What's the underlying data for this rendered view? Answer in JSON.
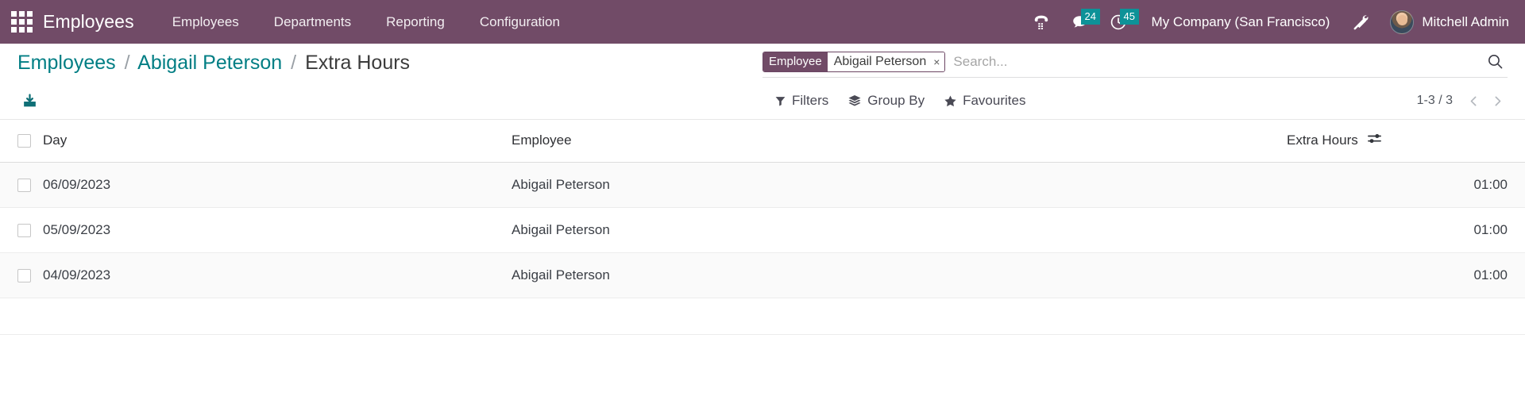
{
  "navbar": {
    "apps_icon": "apps-grid-icon",
    "brand": "Employees",
    "menu": [
      {
        "label": "Employees"
      },
      {
        "label": "Departments"
      },
      {
        "label": "Reporting"
      },
      {
        "label": "Configuration"
      }
    ],
    "systray": {
      "voip_icon": "phone-keypad-icon",
      "messages_icon": "chat-bubble-icon",
      "messages_count": "24",
      "activities_icon": "clock-icon",
      "activities_count": "45",
      "company": "My Company (San Francisco)",
      "debug_icon": "tools-wrench-screwdriver-icon",
      "user_name": "Mitchell Admin",
      "badge_color": "#0d9298"
    }
  },
  "control_panel": {
    "breadcrumb": {
      "root": "Employees",
      "parent": "Abigail Peterson",
      "current": "Extra Hours",
      "separator": "/"
    },
    "search": {
      "facet_label": "Employee",
      "facet_value": "Abigail Peterson",
      "facet_remove": "×",
      "placeholder": "Search...",
      "value": "",
      "search_icon": "magnifier-icon"
    },
    "actions": {
      "export_icon": "download-export-icon"
    },
    "dropdowns": [
      {
        "label": "Filters",
        "icon": "funnel-icon"
      },
      {
        "label": "Group By",
        "icon": "layers-icon"
      },
      {
        "label": "Favourites",
        "icon": "star-icon"
      }
    ],
    "pager": {
      "value": "1-3 / 3",
      "prev_icon": "chevron-left-icon",
      "next_icon": "chevron-right-icon"
    }
  },
  "list": {
    "columns": {
      "select_all": "select-all-checkbox",
      "day": "Day",
      "employee": "Employee",
      "extra_hours": "Extra Hours",
      "optional_columns_icon": "sliders-icon"
    },
    "rows": [
      {
        "day": "06/09/2023",
        "employee": "Abigail Peterson",
        "extra_hours": "01:00"
      },
      {
        "day": "05/09/2023",
        "employee": "Abigail Peterson",
        "extra_hours": "01:00"
      },
      {
        "day": "04/09/2023",
        "employee": "Abigail Peterson",
        "extra_hours": "01:00"
      }
    ]
  },
  "theme": {
    "navbar_bg": "#714B67",
    "link_teal": "#017e84",
    "badge_teal": "#0d9298",
    "footer_bg": "#f4f5f9"
  }
}
